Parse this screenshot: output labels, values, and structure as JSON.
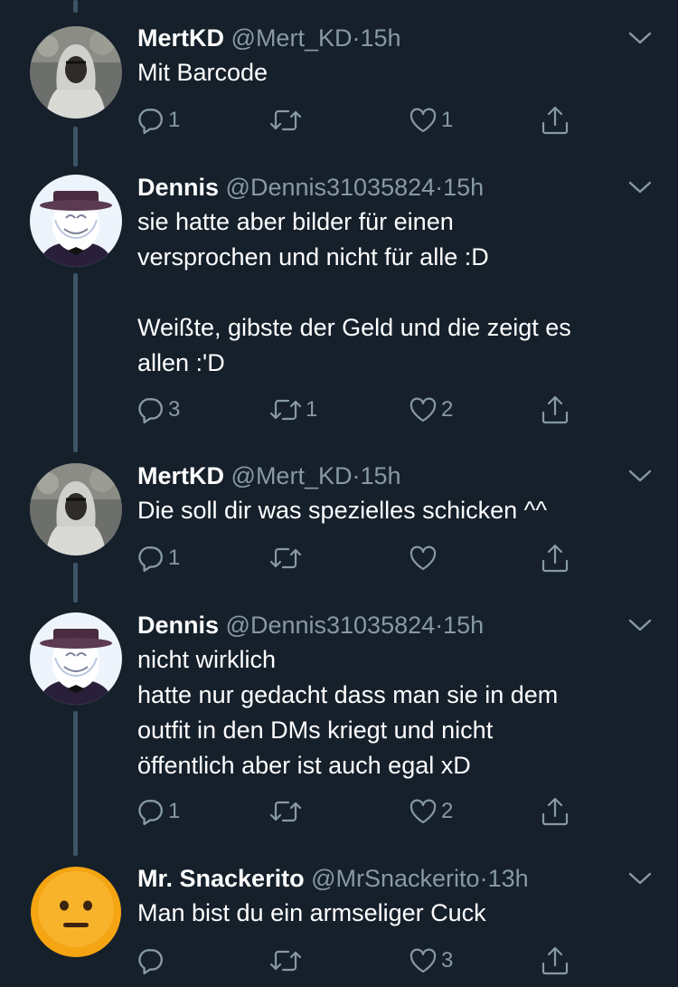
{
  "tweets": [
    {
      "name": "MertKD",
      "handle": "@Mert_KD",
      "sep": "·",
      "time": "15h",
      "text": "Mit Barcode",
      "avatar": "mertkd-avatar",
      "reply_count": "1",
      "retweet_count": "",
      "like_count": "1"
    },
    {
      "name": "Dennis",
      "handle": "@Dennis31035824",
      "sep": "·",
      "time": "15h",
      "text": "sie hatte aber bilder für einen\nversprochen und nicht für alle :D\n\nWeißte, gibste der Geld und die zeigt es\nallen :'D",
      "avatar": "dennis-avatar",
      "reply_count": "3",
      "retweet_count": "1",
      "like_count": "2"
    },
    {
      "name": "MertKD",
      "handle": "@Mert_KD",
      "sep": "·",
      "time": "15h",
      "text": "Die soll dir was spezielles schicken ^^",
      "avatar": "mertkd-avatar",
      "reply_count": "1",
      "retweet_count": "",
      "like_count": ""
    },
    {
      "name": "Dennis",
      "handle": "@Dennis31035824",
      "sep": "·",
      "time": "15h",
      "text": "nicht wirklich\nhatte nur gedacht dass man sie in dem\noutfit in den DMs kriegt und nicht\nöffentlich aber ist auch egal xD",
      "avatar": "dennis-avatar",
      "reply_count": "1",
      "retweet_count": "",
      "like_count": "2"
    },
    {
      "name": "Mr. Snackerito",
      "handle": "@MrSnackerito",
      "sep": "·",
      "time": "13h",
      "text": "Man bist du ein armseliger Cuck",
      "avatar": "emoji-face-avatar",
      "reply_count": "",
      "retweet_count": "",
      "like_count": "3"
    }
  ],
  "colors": {
    "background": "#15202b",
    "secondary_text": "#8899a6",
    "thread_line": "#3d5466"
  },
  "icons": [
    "reply-icon",
    "retweet-icon",
    "like-icon",
    "share-icon",
    "chevron-down-icon"
  ]
}
